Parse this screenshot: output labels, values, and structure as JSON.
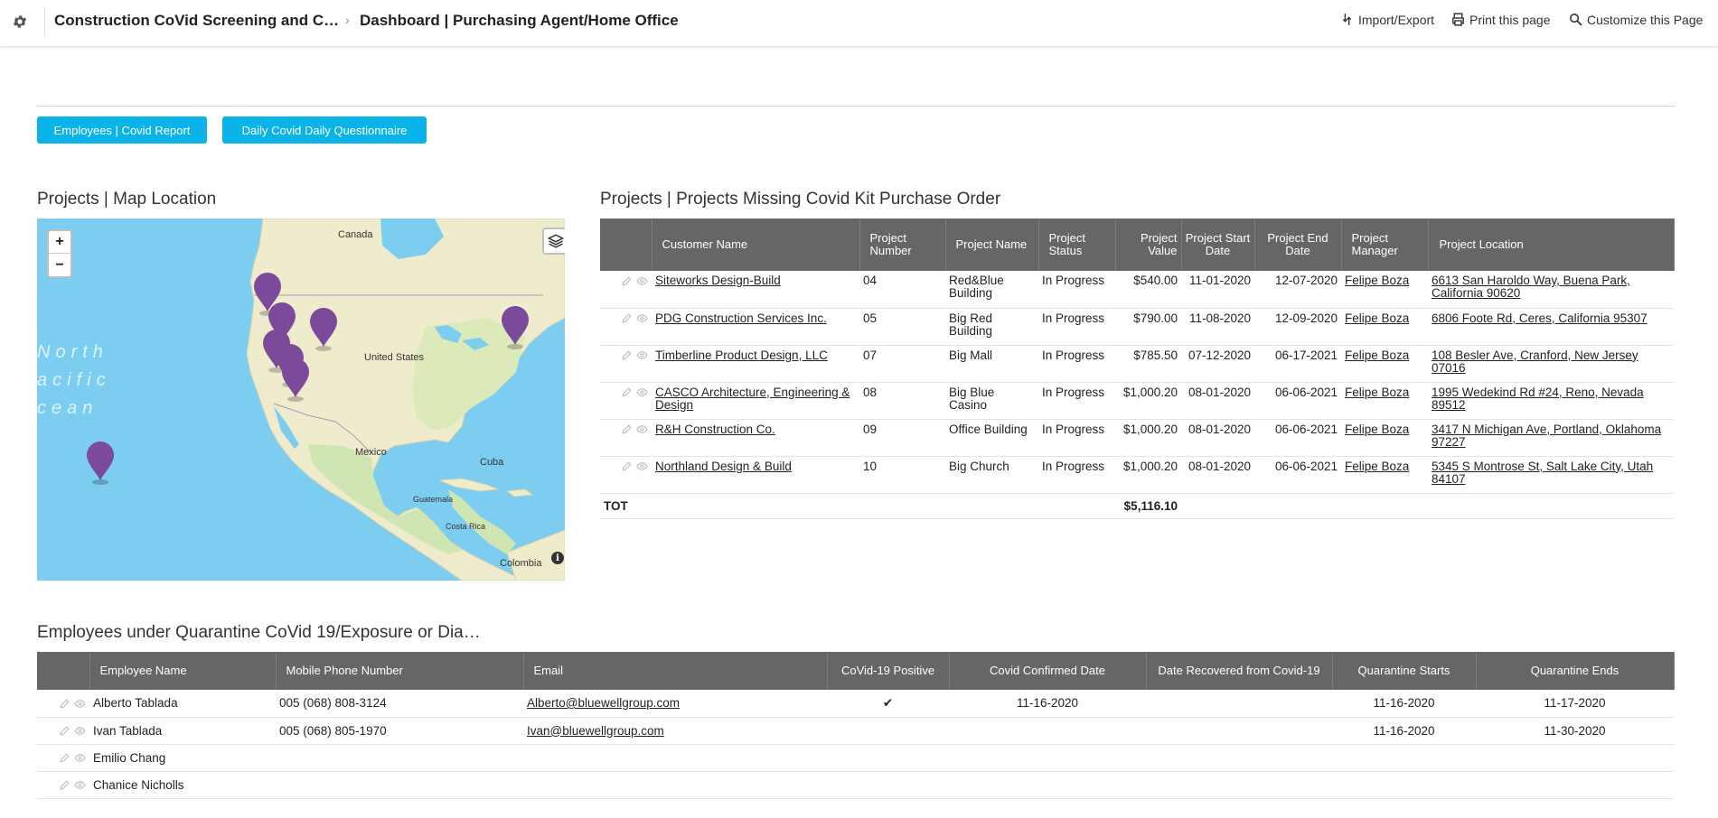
{
  "header": {
    "app_title": "Construction CoVid Screening and C…",
    "page_title": "Dashboard | Purchasing Agent/Home Office",
    "actions": {
      "import_export": "Import/Export",
      "print": "Print this page",
      "customize": "Customize this Page"
    }
  },
  "buttons": {
    "employees_report": "Employees | Covid Report",
    "daily_questionnaire": "Daily Covid Daily Questionnaire"
  },
  "map_section": {
    "title": "Projects | Map Location",
    "zoom_in": "+",
    "zoom_out": "−",
    "info": "i",
    "labels": {
      "canada": "Canada",
      "united_states": "United States",
      "mexico": "Mexico",
      "cuba": "Cuba",
      "guatemala": "Guatemala",
      "costa_rica": "Costa Rica",
      "colombia": "Colombia",
      "ocean_line1": "North",
      "ocean_line2": "acific",
      "ocean_line3": "cean"
    },
    "marker_color": "#7b4a9a"
  },
  "projects_section": {
    "title": "Projects | Projects Missing Covid Kit Purchase Order",
    "columns": [
      "Customer Name",
      "Project Number",
      "Project Name",
      "Project Status",
      "Project Value",
      "Project Start Date",
      "Project End Date",
      "Project Manager",
      "Project Location"
    ],
    "rows": [
      {
        "customer": "Siteworks Design-Build",
        "number": "04",
        "name": "Red&Blue Building",
        "status": "In Progress",
        "value": "$540.00",
        "start": "11-01-2020",
        "end": "12-07-2020",
        "manager": "Felipe Boza",
        "location": "6613 San Haroldo Way, Buena Park, California 90620"
      },
      {
        "customer": "PDG Construction Services Inc.",
        "number": "05",
        "name": "Big Red Building",
        "status": "In Progress",
        "value": "$790.00",
        "start": "11-08-2020",
        "end": "12-09-2020",
        "manager": "Felipe Boza",
        "location": "6806 Foote Rd, Ceres, California 95307"
      },
      {
        "customer": "Timberline Product Design, LLC",
        "number": "07",
        "name": "Big Mall",
        "status": "In Progress",
        "value": "$785.50",
        "start": "07-12-2020",
        "end": "06-17-2021",
        "manager": "Felipe Boza",
        "location": "108 Besler Ave, Cranford, New Jersey 07016"
      },
      {
        "customer": "CASCO Architecture, Engineering & Design",
        "number": "08",
        "name": "Big Blue Casino",
        "status": "In Progress",
        "value": "$1,000.20",
        "start": "08-01-2020",
        "end": "06-06-2021",
        "manager": "Felipe Boza",
        "location": "1995 Wedekind Rd #24, Reno, Nevada 89512"
      },
      {
        "customer": "R&H Construction Co.",
        "number": "09",
        "name": "Office Building",
        "status": "In Progress",
        "value": "$1,000.20",
        "start": "08-01-2020",
        "end": "06-06-2021",
        "manager": "Felipe Boza",
        "location": "3417 N Michigan Ave, Portland, Oklahoma 97227"
      },
      {
        "customer": "Northland Design & Build",
        "number": "10",
        "name": "Big Church",
        "status": "In Progress",
        "value": "$1,000.20",
        "start": "08-01-2020",
        "end": "06-06-2021",
        "manager": "Felipe Boza",
        "location": "5345 S Montrose St, Salt Lake City, Utah 84107"
      }
    ],
    "total_label": "TOT",
    "total_value": "$5,116.10"
  },
  "employees_section": {
    "title": "Employees under Quarantine CoVid 19/Exposure or Dia…",
    "columns": [
      "Employee Name",
      "Mobile Phone Number",
      "Email",
      "CoVid-19 Positive",
      "Covid Confirmed Date",
      "Date Recovered from Covid-19",
      "Quarantine Starts",
      "Quarantine Ends"
    ],
    "rows": [
      {
        "name": "Alberto Tablada",
        "phone": "005 (068) 808-3124",
        "email": "Alberto@bluewellgroup.com",
        "positive": "✔",
        "confirmed": "11-16-2020",
        "recovered": "",
        "q_start": "11-16-2020",
        "q_end": "11-17-2020"
      },
      {
        "name": "Ivan Tablada",
        "phone": "005 (068) 805-1970",
        "email": "Ivan@bluewellgroup.com",
        "positive": "",
        "confirmed": "",
        "recovered": "",
        "q_start": "11-16-2020",
        "q_end": "11-30-2020"
      },
      {
        "name": "Emilio Chang",
        "phone": "",
        "email": "",
        "positive": "",
        "confirmed": "",
        "recovered": "",
        "q_start": "",
        "q_end": ""
      },
      {
        "name": "Chanice Nicholls",
        "phone": "",
        "email": "",
        "positive": "",
        "confirmed": "",
        "recovered": "",
        "q_start": "",
        "q_end": ""
      }
    ]
  },
  "colors": {
    "accent_button": "#0ab4e8",
    "table_header": "#666666"
  }
}
